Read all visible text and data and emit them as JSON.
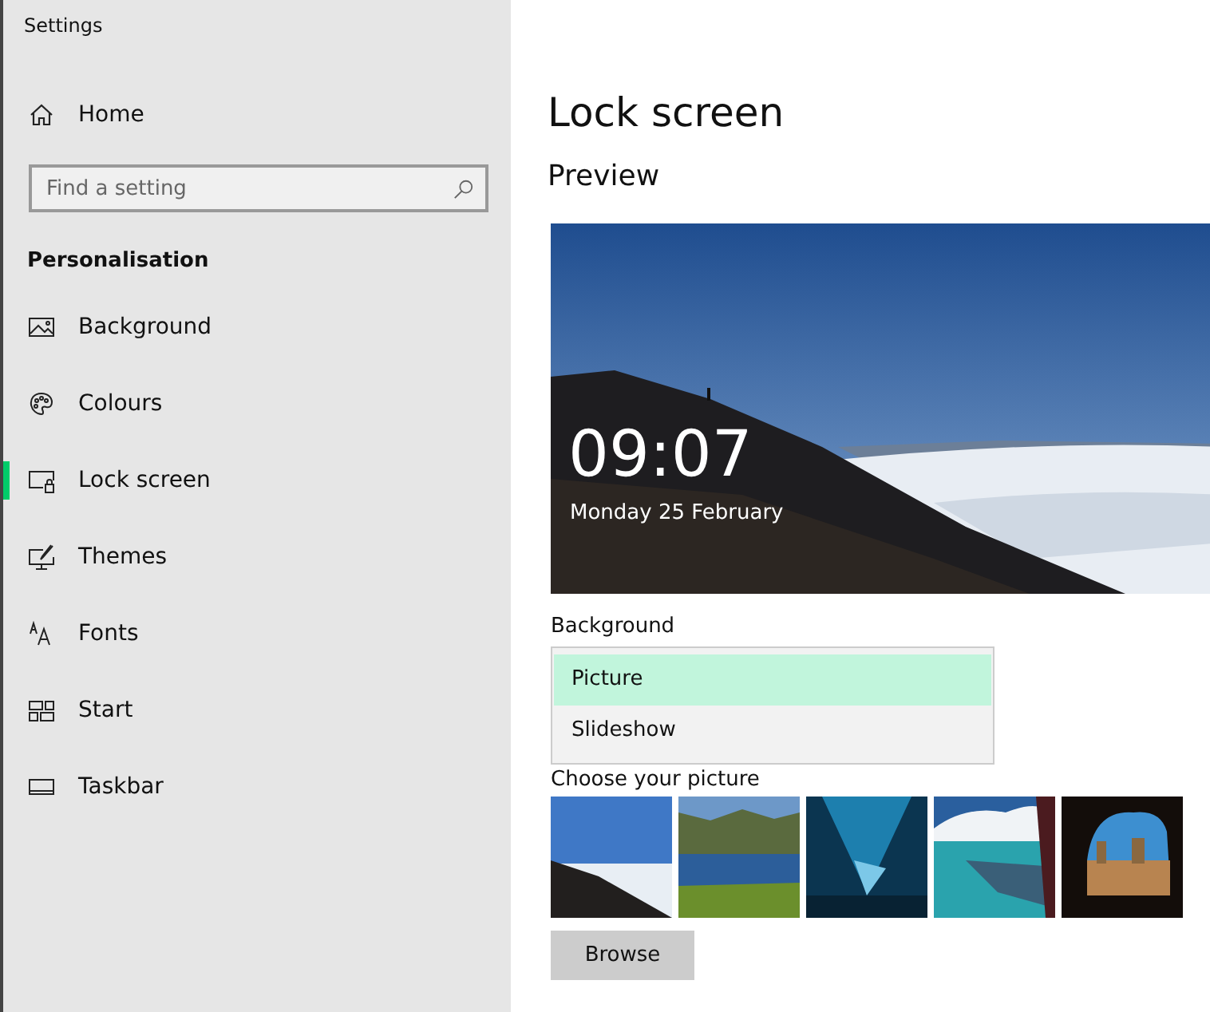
{
  "window": {
    "title": "Settings"
  },
  "sidebar": {
    "home": {
      "label": "Home"
    },
    "search": {
      "placeholder": "Find a setting"
    },
    "section": "Personalisation",
    "items": [
      {
        "label": "Background",
        "selected": false
      },
      {
        "label": "Colours",
        "selected": false
      },
      {
        "label": "Lock screen",
        "selected": true
      },
      {
        "label": "Themes",
        "selected": false
      },
      {
        "label": "Fonts",
        "selected": false
      },
      {
        "label": "Start",
        "selected": false
      },
      {
        "label": "Taskbar",
        "selected": false
      }
    ]
  },
  "page": {
    "title": "Lock screen",
    "preview_heading": "Preview",
    "preview": {
      "kind": "picture",
      "time": "09:07",
      "date": "Monday 25 February"
    },
    "background_label": "Background",
    "background_options": [
      {
        "label": "Picture",
        "selected": true
      },
      {
        "label": "Slideshow",
        "selected": false
      }
    ],
    "choose_label": "Choose your picture",
    "browse_button": "Browse"
  }
}
